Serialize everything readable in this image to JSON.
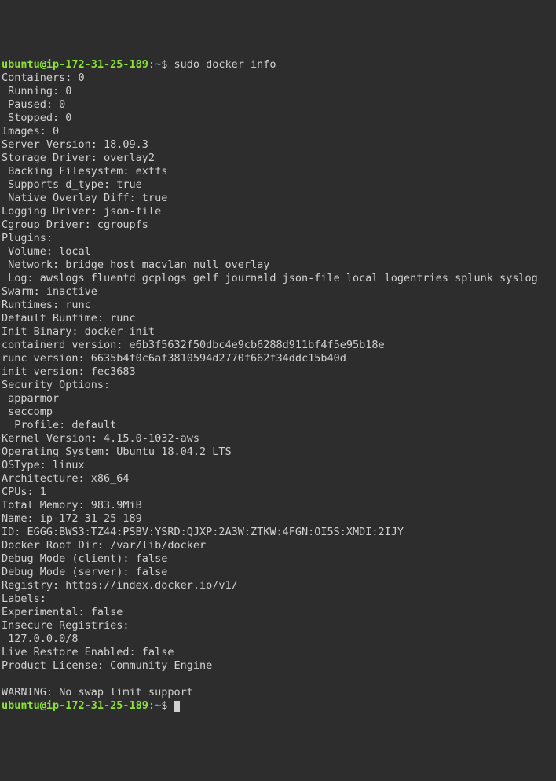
{
  "prompt": {
    "user_host": "ubuntu@ip-172-31-25-189",
    "colon": ":",
    "path": "~",
    "dollar": "$ "
  },
  "command": "sudo docker info",
  "lines": [
    "Containers: 0",
    " Running: 0",
    " Paused: 0",
    " Stopped: 0",
    "Images: 0",
    "Server Version: 18.09.3",
    "Storage Driver: overlay2",
    " Backing Filesystem: extfs",
    " Supports d_type: true",
    " Native Overlay Diff: true",
    "Logging Driver: json-file",
    "Cgroup Driver: cgroupfs",
    "Plugins:",
    " Volume: local",
    " Network: bridge host macvlan null overlay",
    " Log: awslogs fluentd gcplogs gelf journald json-file local logentries splunk syslog",
    "Swarm: inactive",
    "Runtimes: runc",
    "Default Runtime: runc",
    "Init Binary: docker-init",
    "containerd version: e6b3f5632f50dbc4e9cb6288d911bf4f5e95b18e",
    "runc version: 6635b4f0c6af3810594d2770f662f34ddc15b40d",
    "init version: fec3683",
    "Security Options:",
    " apparmor",
    " seccomp",
    "  Profile: default",
    "Kernel Version: 4.15.0-1032-aws",
    "Operating System: Ubuntu 18.04.2 LTS",
    "OSType: linux",
    "Architecture: x86_64",
    "CPUs: 1",
    "Total Memory: 983.9MiB",
    "Name: ip-172-31-25-189",
    "ID: EGGG:BWS3:TZ44:PSBV:YSRD:QJXP:2A3W:ZTKW:4FGN:OI5S:XMDI:2IJY",
    "Docker Root Dir: /var/lib/docker",
    "Debug Mode (client): false",
    "Debug Mode (server): false",
    "Registry: https://index.docker.io/v1/",
    "Labels:",
    "Experimental: false",
    "Insecure Registries:",
    " 127.0.0.0/8",
    "Live Restore Enabled: false",
    "Product License: Community Engine",
    "",
    "WARNING: No swap limit support"
  ]
}
